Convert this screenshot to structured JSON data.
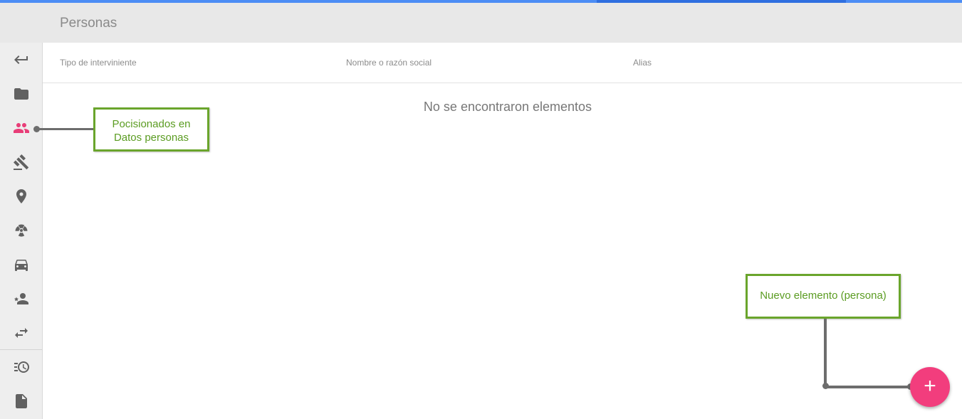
{
  "header": {
    "title": "Personas"
  },
  "sidebar": {
    "items": [
      {
        "icon": "back-arrow-icon",
        "active": false
      },
      {
        "icon": "folder-icon",
        "active": false
      },
      {
        "icon": "people-icon",
        "active": true
      },
      {
        "icon": "gavel-icon",
        "active": false
      },
      {
        "icon": "location-pin-icon",
        "active": false
      },
      {
        "icon": "radiation-icon",
        "active": false
      },
      {
        "icon": "car-icon",
        "active": false
      },
      {
        "icon": "person-star-icon",
        "active": false
      },
      {
        "icon": "swap-icon",
        "active": false
      },
      {
        "icon": "history-list-icon",
        "active": false
      },
      {
        "icon": "document-icon",
        "active": false
      }
    ],
    "accent_color": "#e83e78"
  },
  "table": {
    "columns": [
      "Tipo de interviniente",
      "Nombre o razón social",
      "Alias"
    ],
    "empty_message": "No se encontraron elementos"
  },
  "annotations": {
    "callout_1_line1": "Pocisionados en",
    "callout_1_line2": "Datos personas",
    "callout_2": "Nuevo elemento (persona)"
  },
  "fab": {
    "label": "+",
    "color": "#f23d7d"
  }
}
